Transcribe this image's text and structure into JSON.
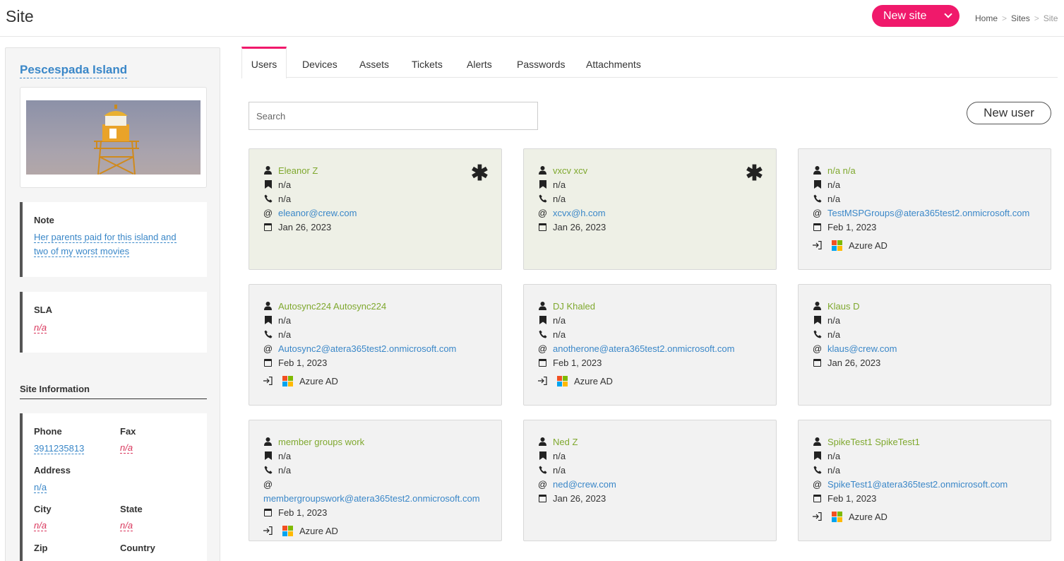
{
  "header": {
    "title": "Site",
    "new_site_label": "New site",
    "breadcrumb": [
      "Home",
      "Sites",
      "Site"
    ],
    "accent_color": "#f0196b"
  },
  "sidebar": {
    "site_name": "Pescespada Island",
    "note": {
      "label": "Note",
      "value": "Her parents paid for this island and two of my worst movies"
    },
    "sla": {
      "label": "SLA",
      "value": "n/a"
    },
    "site_info_title": "Site Information",
    "fields": {
      "phone": {
        "label": "Phone",
        "value": "3911235813"
      },
      "fax": {
        "label": "Fax",
        "value": "n/a"
      },
      "address": {
        "label": "Address",
        "value": "n/a"
      },
      "city": {
        "label": "City",
        "value": "n/a"
      },
      "state": {
        "label": "State",
        "value": "n/a"
      },
      "zip": {
        "label": "Zip"
      },
      "country": {
        "label": "Country"
      }
    }
  },
  "tabs": [
    "Users",
    "Devices",
    "Assets",
    "Tickets",
    "Alerts",
    "Passwords",
    "Attachments"
  ],
  "active_tab": "Users",
  "search": {
    "placeholder": "Search"
  },
  "new_user_label": "New user",
  "users": [
    {
      "name": "Eleanor Z",
      "title": "n/a",
      "phone": "n/a",
      "email_prefix": "@",
      "email": "eleanor@crew.com",
      "date": "Jan 26, 2023",
      "starred": true,
      "highlight": true
    },
    {
      "name": "vxcv xcv",
      "title": "n/a",
      "phone": "n/a",
      "email_prefix": "@",
      "email": "xcvx@h.com",
      "date": "Jan 26, 2023",
      "starred": true,
      "highlight": true
    },
    {
      "name": "n/a n/a",
      "title": "n/a",
      "phone": "n/a",
      "email_prefix": "@",
      "email": "TestMSPGroups@atera365test2.onmicrosoft.com",
      "date": "Feb 1, 2023",
      "source": "Azure AD"
    },
    {
      "name": "Autosync224 Autosync224",
      "title": "n/a",
      "phone": "n/a",
      "email_prefix": "@",
      "email": "Autosync2@atera365test2.onmicrosoft.com",
      "date": "Feb 1, 2023",
      "source": "Azure AD"
    },
    {
      "name": "DJ Khaled",
      "title": "n/a",
      "phone": "n/a",
      "email_prefix": "@",
      "email": "anotherone@atera365test2.onmicrosoft.com",
      "date": "Feb 1, 2023",
      "source": "Azure AD"
    },
    {
      "name": "Klaus D",
      "title": "n/a",
      "phone": "n/a",
      "email_prefix": "@",
      "email": "klaus@crew.com",
      "date": "Jan 26, 2023"
    },
    {
      "name": "member groups work",
      "title": "n/a",
      "phone": "n/a",
      "email_prefix": "@",
      "email": "membergroupswork@atera365test2.onmicrosoft.com",
      "date": "Feb 1, 2023",
      "source": "Azure AD",
      "wrap_email": true
    },
    {
      "name": "Ned Z",
      "title": "n/a",
      "phone": "n/a",
      "email_prefix": "@",
      "email": "ned@crew.com",
      "date": "Jan 26, 2023"
    },
    {
      "name": "SpikeTest1 SpikeTest1",
      "title": "n/a",
      "phone": "n/a",
      "email_prefix": "@",
      "email": "SpikeTest1@atera365test2.onmicrosoft.com",
      "date": "Feb 1, 2023",
      "source": "Azure AD"
    }
  ],
  "icons": {
    "user": "user-icon",
    "title": "bookmark-icon",
    "phone": "phone-icon",
    "email": "at-icon",
    "date": "calendar-icon",
    "source": "sign-in-icon",
    "microsoft": "microsoft-logo-icon",
    "star": "asterisk-icon"
  },
  "colors": {
    "name": "#7fa82e",
    "link": "#3a87c8",
    "na": "#d9365c",
    "card_highlight": "#eef0e6"
  }
}
